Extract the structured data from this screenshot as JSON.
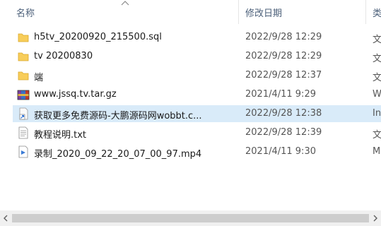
{
  "header": {
    "name_label": "名称",
    "date_label": "修改日期",
    "type_label": "类"
  },
  "files": [
    {
      "name": "h5tv_20200920_215500.sql",
      "date": "2022/9/28 12:29",
      "type": "文",
      "icon": "folder-icon"
    },
    {
      "name": "tv 20200830",
      "date": "2022/9/28 12:29",
      "type": "文",
      "icon": "folder-icon"
    },
    {
      "name": "端",
      "date": "2022/9/28 12:37",
      "type": "文",
      "icon": "folder-icon"
    },
    {
      "name": "www.jssq.tv.tar.gz",
      "date": "2021/4/11 9:29",
      "type": "W",
      "icon": "archive-icon"
    },
    {
      "name": "获取更多免费源码-大鹏源码网wobbt.c...",
      "date": "2022/9/28 12:38",
      "type": "In",
      "icon": "shortcut-icon"
    },
    {
      "name": "教程说明.txt",
      "date": "2022/9/28 12:39",
      "type": "文",
      "icon": "text-file-icon"
    },
    {
      "name": "录制_2020_09_22_20_07_00_97.mp4",
      "date": "2021/4/11 9:30",
      "type": "M",
      "icon": "video-file-icon"
    }
  ],
  "selected_index": 4,
  "colors": {
    "folder": "#f8cd5a",
    "selection": "#d9ebf9",
    "header_text": "#4c607a"
  }
}
